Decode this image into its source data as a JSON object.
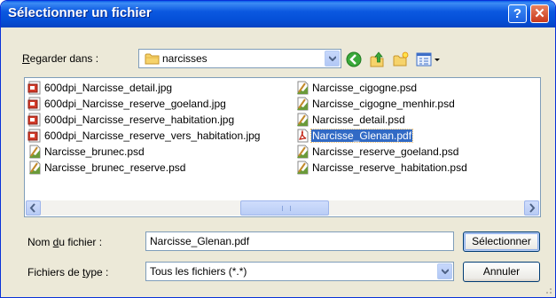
{
  "window": {
    "title": "Sélectionner un fichier"
  },
  "lookin": {
    "label_prefix": "",
    "label_u": "R",
    "label_rest": "egarder dans :",
    "value": "narcisses"
  },
  "files": [
    {
      "name": "600dpi_Narcisse_detail.jpg",
      "type": "jpg"
    },
    {
      "name": "600dpi_Narcisse_reserve_goeland.jpg",
      "type": "jpg"
    },
    {
      "name": "600dpi_Narcisse_reserve_habitation.jpg",
      "type": "jpg"
    },
    {
      "name": "600dpi_Narcisse_reserve_vers_habitation.jpg",
      "type": "jpg"
    },
    {
      "name": "Narcisse_brunec.psd",
      "type": "psd"
    },
    {
      "name": "Narcisse_brunec_reserve.psd",
      "type": "psd"
    },
    {
      "name": "Narcisse_cigogne.psd",
      "type": "psd"
    },
    {
      "name": "Narcisse_cigogne_menhir.psd",
      "type": "psd"
    },
    {
      "name": "Narcisse_detail.psd",
      "type": "psd"
    },
    {
      "name": "Narcisse_Glenan.pdf",
      "type": "pdf",
      "selected": true
    },
    {
      "name": "Narcisse_reserve_goeland.psd",
      "type": "psd"
    },
    {
      "name": "Narcisse_reserve_habitation.psd",
      "type": "psd"
    }
  ],
  "filename": {
    "label_prefix": "Nom ",
    "label_u": "d",
    "label_rest": "u fichier :",
    "value": "Narcisse_Glenan.pdf"
  },
  "filetype": {
    "label_prefix": "Fichiers de ",
    "label_u": "t",
    "label_rest": "ype :",
    "value": "Tous les fichiers (*.*)"
  },
  "buttons": {
    "select": "Sélectionner",
    "cancel": "Annuler",
    "help": "?",
    "close": "✕"
  },
  "colors": {
    "titlebar": "#0550d8",
    "selection": "#316ac5",
    "face": "#ece9d8"
  }
}
